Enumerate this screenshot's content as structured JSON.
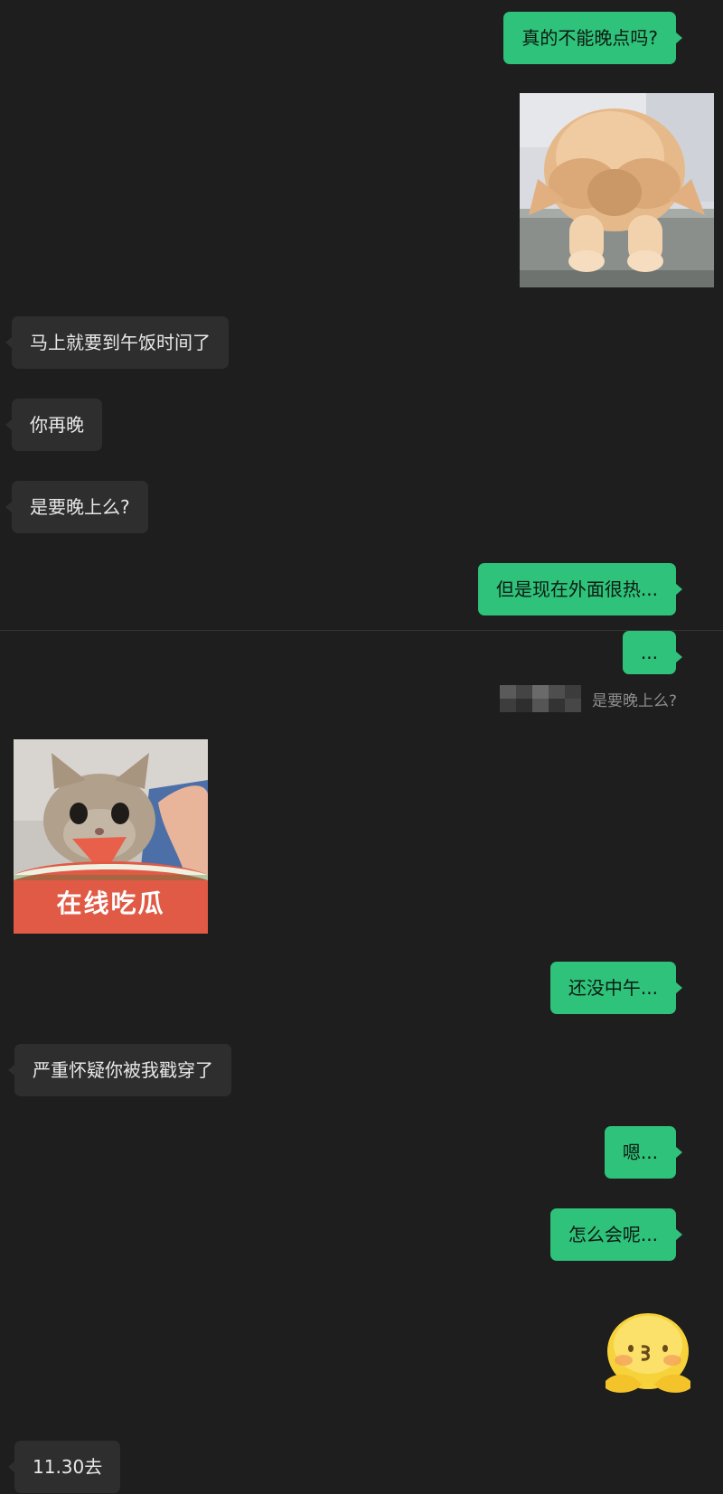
{
  "messages": [
    {
      "side": "out",
      "text": "真的不能晚点吗?"
    },
    {
      "side": "in",
      "text": "马上就要到午饭时间了"
    },
    {
      "side": "in",
      "text": "你再晚"
    },
    {
      "side": "in",
      "text": "是要晚上么?"
    },
    {
      "side": "out",
      "text": "但是现在外面很热..."
    },
    {
      "side": "out",
      "text": "..."
    },
    {
      "side": "out",
      "text": "还没中午..."
    },
    {
      "side": "in",
      "text": "严重怀疑你被我戳穿了"
    },
    {
      "side": "out",
      "text": "嗯..."
    },
    {
      "side": "out",
      "text": "怎么会呢..."
    },
    {
      "side": "in",
      "text": "11.30去"
    }
  ],
  "quote": {
    "text": "是要晚上么?"
  },
  "sticker_watermelon": {
    "caption": "在线吃瓜"
  },
  "icons": {
    "sticker_cat": "cat-peeking-icon",
    "sticker_watermelon": "cat-eating-watermelon-icon",
    "emoji": "shy-hug-emoji-icon"
  },
  "colors": {
    "background": "#1e1e1e",
    "outgoing_bubble": "#2fc27a",
    "incoming_bubble": "#2e2e2e"
  }
}
